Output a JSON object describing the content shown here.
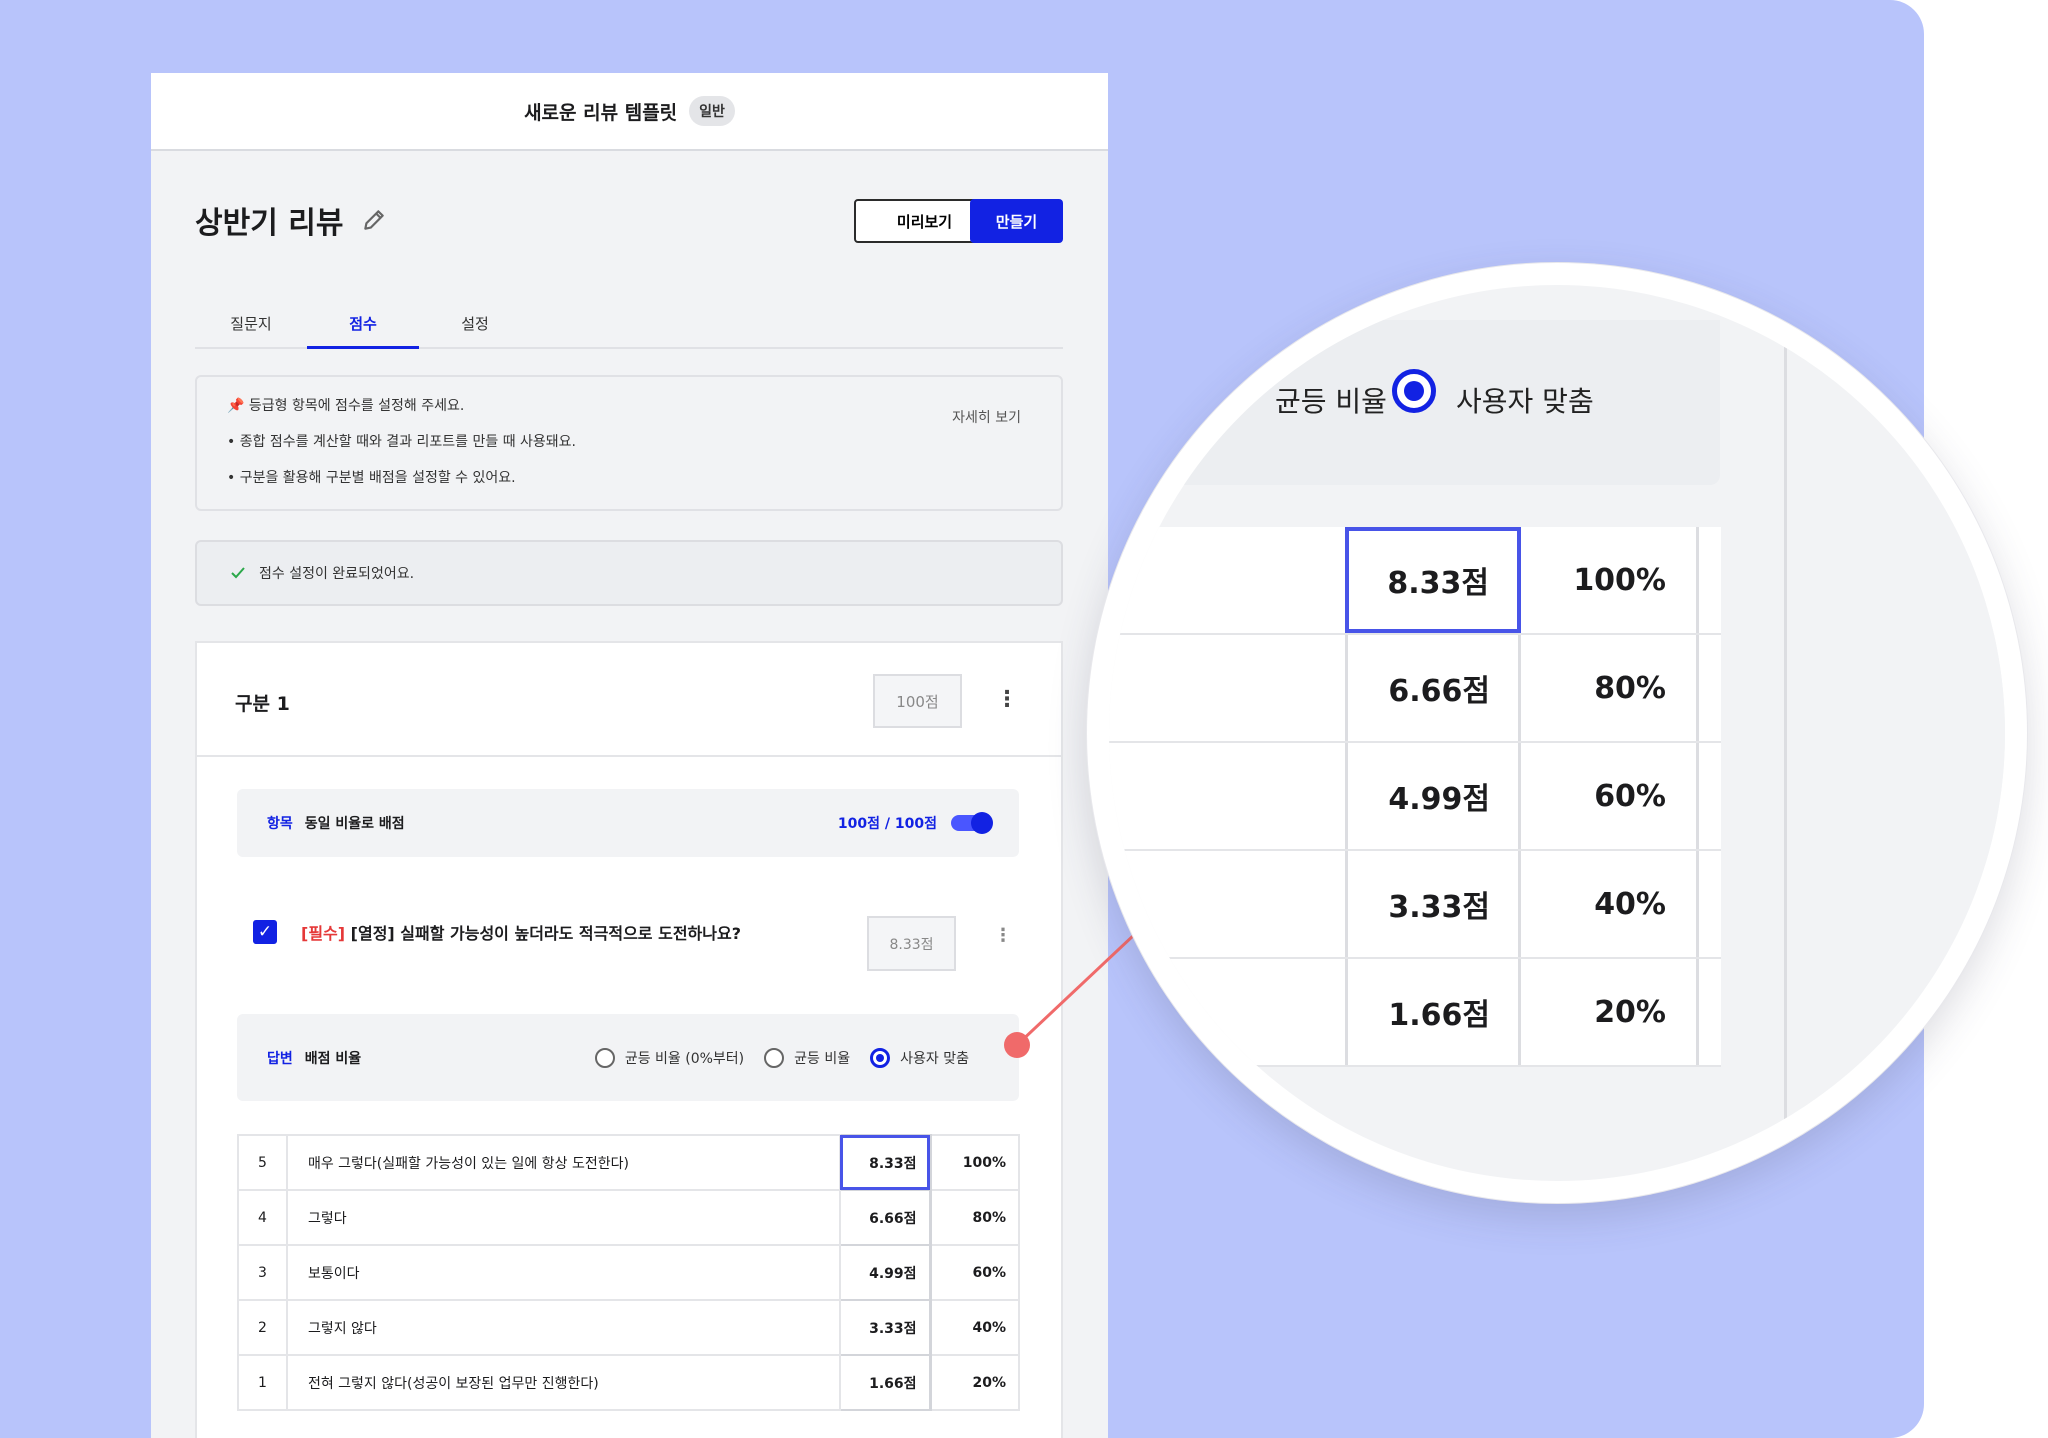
{
  "header": {
    "title": "새로운 리뷰 템플릿",
    "badge": "일반"
  },
  "page": {
    "title": "상반기 리뷰",
    "preview_label": "미리보기",
    "create_label": "만들기"
  },
  "tabs": [
    {
      "label": "질문지"
    },
    {
      "label": "점수"
    },
    {
      "label": "설정"
    }
  ],
  "info": {
    "heading": "📌 등급형 항목에 점수를 설정해 주세요.",
    "bullets": [
      "• 종합 점수를 계산할 때와 결과 리포트를 만들 때 사용돼요.",
      "• 구분을 활용해 구분별 배점을 설정할 수 있어요."
    ],
    "more_link": "자세히 보기"
  },
  "status": {
    "text": "점수 설정이 완료되었어요."
  },
  "section": {
    "title": "구분 1",
    "score_placeholder": "100점",
    "item_bar": {
      "tag": "항목",
      "label": "동일 비율로 배점",
      "ratio": "100점 / 100점"
    },
    "question": {
      "required": "[필수]",
      "text": "[열정] 실패할 가능성이 높더라도 적극적으로 도전하나요?",
      "score_placeholder": "8.33점"
    },
    "answer_bar": {
      "tag": "답변",
      "label": "배점 비율",
      "options": [
        {
          "label": "균등 비율 (0%부터)"
        },
        {
          "label": "균등 비율"
        },
        {
          "label": "사용자 맞춤"
        }
      ]
    },
    "answers": [
      {
        "n": "5",
        "label": "매우 그렇다(실패할 가능성이 있는 일에 항상 도전한다)",
        "points": "8.33점",
        "pct": "100%"
      },
      {
        "n": "4",
        "label": "그렇다",
        "points": "6.66점",
        "pct": "80%"
      },
      {
        "n": "3",
        "label": "보통이다",
        "points": "4.99점",
        "pct": "60%"
      },
      {
        "n": "2",
        "label": "그렇지 않다",
        "points": "3.33점",
        "pct": "40%"
      },
      {
        "n": "1",
        "label": "전혀 그렇지 않다(성공이 보장된 업무만 진행한다)",
        "points": "1.66점",
        "pct": "20%"
      }
    ]
  },
  "zoom": {
    "option_equal": "균등 비율",
    "option_custom": "사용자 맞춤",
    "rows": [
      {
        "points": "8.33점",
        "pct": "100%"
      },
      {
        "points": "6.66점",
        "pct": "80%"
      },
      {
        "points": "4.99점",
        "pct": "60%"
      },
      {
        "points": "3.33점",
        "pct": "40%"
      },
      {
        "points": "1.66점",
        "pct": "20%"
      }
    ]
  },
  "colors": {
    "background": "#b8c4fb",
    "accent": "#1222e3",
    "connector": "#f06a6a",
    "required": "#e53838"
  }
}
